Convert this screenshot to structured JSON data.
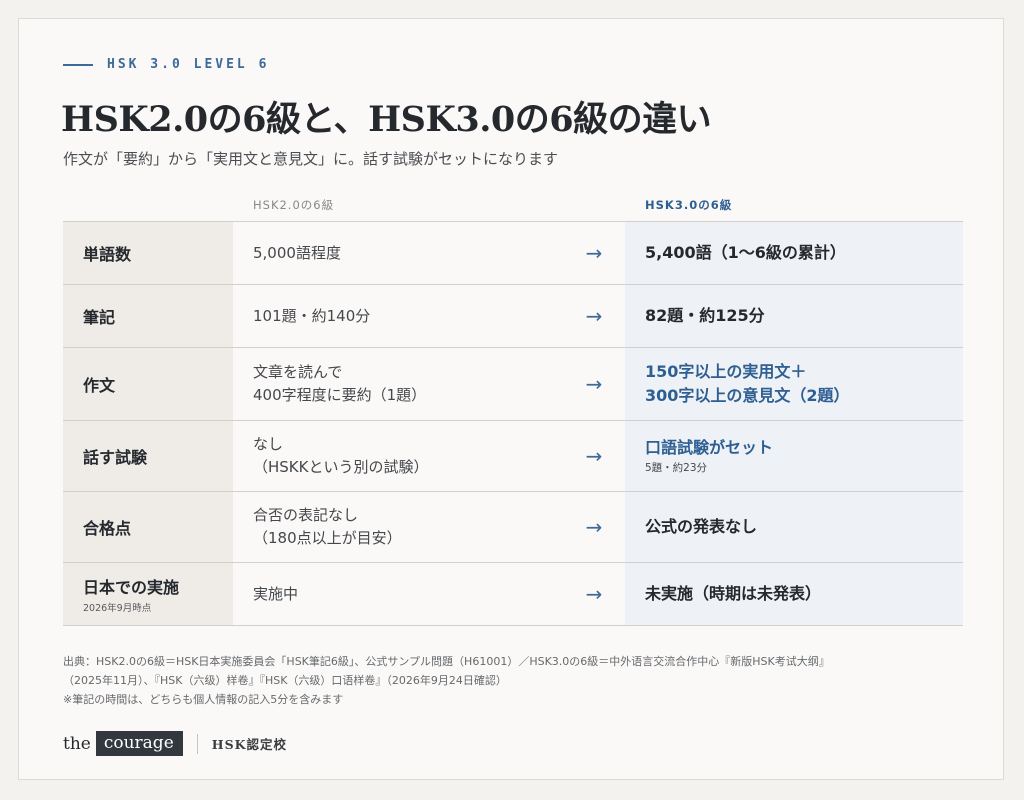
{
  "eyebrow": "HSK 3.0 LEVEL 6",
  "title": "HSK2.0の6級と、HSK3.0の6級の違い",
  "subtitle": "作文が「要約」から「実用文と意見文」に。話す試験がセットになります",
  "table": {
    "header_old": "HSK2.0の6級",
    "header_new": "HSK3.0の6級",
    "arrow": "→",
    "rows": [
      {
        "label": "単語数",
        "old_lines": [
          "5,000語程度"
        ],
        "new_lines": [
          "5,400語（1〜6級の累計）"
        ]
      },
      {
        "label": "筆記",
        "old_lines": [
          "101題・約140分"
        ],
        "new_lines": [
          "82題・約125分"
        ]
      },
      {
        "label": "作文",
        "old_lines": [
          "文章を読んで",
          "400字程度に要約（1題）"
        ],
        "new_lines": [
          "150字以上の実用文＋",
          "300字以上の意見文（2題）"
        ]
      },
      {
        "label": "話す試験",
        "old_lines": [
          "なし",
          "（HSKKという別の試験）"
        ],
        "new_lines": [
          "口語試験がセット"
        ],
        "new_sub": "5題・約23分"
      },
      {
        "label": "合格点",
        "old_lines": [
          "合否の表記なし",
          "（180点以上が目安）"
        ],
        "new_lines": [
          "公式の発表なし"
        ]
      },
      {
        "label": "日本での実施",
        "label_sub": "2026年9月時点",
        "old_lines": [
          "実施中"
        ],
        "new_lines": [
          "未実施（時期は未発表）"
        ]
      }
    ]
  },
  "footnote": {
    "line1": "出典：HSK2.0の6級＝HSK日本実施委員会「HSK筆記6級」、公式サンプル問題（H61001）／HSK3.0の6級＝中外语言交流合作中心『新版HSK考试大纲』",
    "line2": "（2025年11月）、『HSK（六级）样卷』『HSK（六级）口语样卷』（2026年9月24日確認）",
    "line3": "※筆記の時間は、どちらも個人情報の記入5分を含みます"
  },
  "brand": {
    "the": "the",
    "courage": "courage",
    "name": "HSK認定校"
  },
  "colors": {
    "accent": "#3d6a98",
    "new_bg": "#eef1f5",
    "label_bg": "#efece8"
  }
}
